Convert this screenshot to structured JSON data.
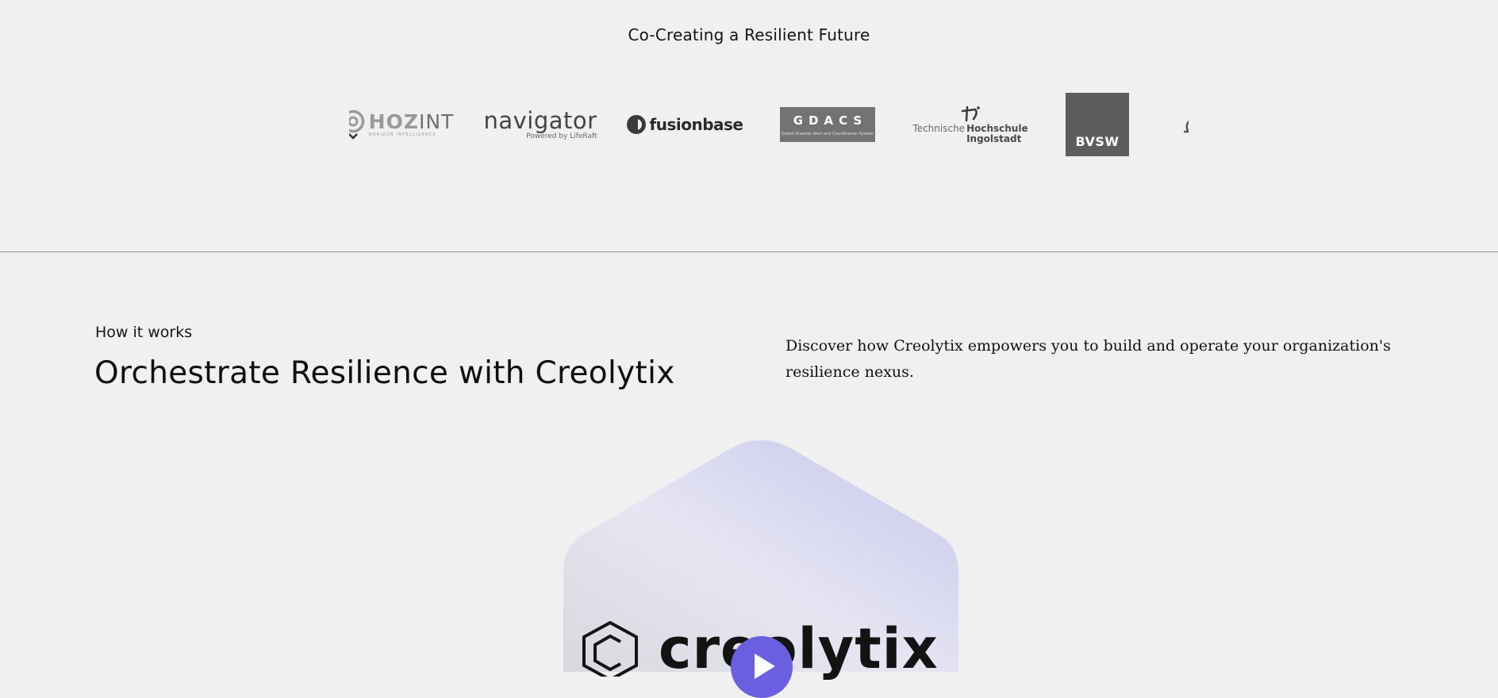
{
  "partners": {
    "title": "Co-Creating a Resilient Future",
    "logos": {
      "hozint": {
        "name": "HOZINT",
        "name_part1": "HOZ",
        "name_part2": "INT",
        "tagline": "HORIZON INTELLIGENCE"
      },
      "navigator": {
        "name": "navigator",
        "tagline": "Powered by LifeRaft"
      },
      "fusionbase": {
        "name": "fusionbase"
      },
      "gdacs": {
        "name": "GDACS",
        "tagline": "Global Disaster Alert and Coordination System"
      },
      "thi": {
        "line1": "Technische",
        "line2": "Hochschule",
        "line3": "Ingolstadt"
      },
      "bvsw": {
        "name": "BVSW"
      }
    }
  },
  "how_it_works": {
    "kicker": "How it works",
    "title": "Orchestrate Resilience with Creolytix",
    "description": "Discover how Creolytix empowers you to build and operate your organization's resilience nexus."
  },
  "video": {
    "brand_wordmark": "creolytix",
    "play_icon": "play-icon"
  },
  "colors": {
    "background": "#f0f0f0",
    "accent": "#6a5fe0",
    "hexagon_gradient": [
      "#dcdce0",
      "#e5e5f2",
      "#c9c8ee"
    ]
  }
}
